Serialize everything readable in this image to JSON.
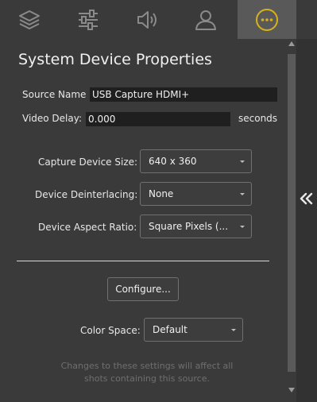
{
  "tabs": [
    {
      "icon": "layers-icon",
      "active": false
    },
    {
      "icon": "sliders-icon",
      "active": false
    },
    {
      "icon": "speaker-icon",
      "active": false
    },
    {
      "icon": "person-icon",
      "active": false
    },
    {
      "icon": "more-options-icon",
      "active": true
    }
  ],
  "accent_color": "#d8b21a",
  "panel": {
    "title": "System Device Properties",
    "source_name_label": "Source Name",
    "source_name_value": "USB Capture HDMI+",
    "video_delay_label": "Video Delay:",
    "video_delay_value": "0.000",
    "video_delay_unit": "seconds",
    "capture_size_label": "Capture Device Size:",
    "capture_size_value": "640 x 360",
    "deinterlacing_label": "Device Deinterlacing:",
    "deinterlacing_value": "None",
    "aspect_label": "Device Aspect Ratio:",
    "aspect_value": "Square Pixels (...",
    "configure_button": "Configure...",
    "color_space_label": "Color Space:",
    "color_space_value": "Default",
    "note_line1": "Changes to these settings will affect all",
    "note_line2": "shots containing this source."
  },
  "collapse_glyph": "«"
}
